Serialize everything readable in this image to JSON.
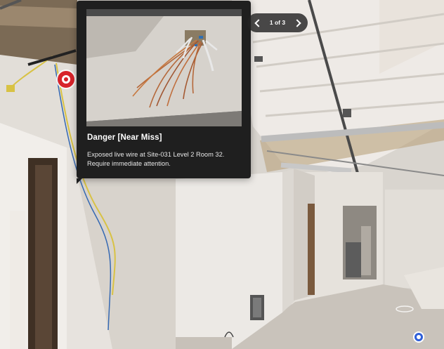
{
  "annotation": {
    "title": "Danger [Near Miss]",
    "description": "Exposed live wire at Site-031 Level 2 Room 32. Require immediate attention."
  },
  "pager": {
    "label": "1 of 3"
  },
  "colors": {
    "hotspot_danger": "#d8232a",
    "nav_point": "#2f5fd8",
    "card_background": "#1f1f1f"
  },
  "icons": {
    "prev": "chevron-left-icon",
    "next": "chevron-right-icon",
    "hotspot": "danger-hotspot-icon",
    "nav": "navigation-point-icon"
  }
}
